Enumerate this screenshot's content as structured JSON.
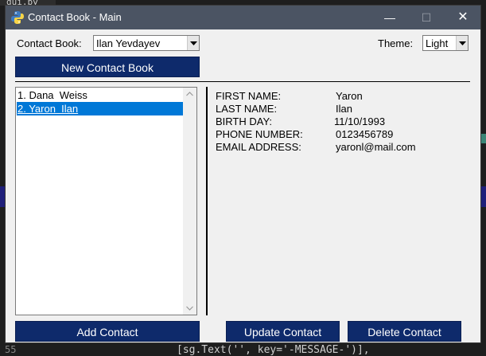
{
  "editor": {
    "tab_label": "gui.py",
    "line_number": "55",
    "code_line": "[sg.Text('', key='-MESSAGE-')],"
  },
  "window": {
    "title": "Contact Book - Main",
    "minimize_glyph": "—",
    "maximize_glyph": "☐",
    "close_glyph": "✕"
  },
  "header": {
    "contact_book_label": "Contact Book:",
    "contact_book_value": "Ilan Yevdayev",
    "theme_label": "Theme:",
    "theme_value": "Light",
    "new_contact_book_button": "New Contact Book"
  },
  "contacts": [
    {
      "label": "1. Dana  Weiss",
      "selected": false
    },
    {
      "label": "2. Yaron  Ilan",
      "selected": true
    }
  ],
  "details": {
    "first_name_label": "FIRST NAME:",
    "first_name_value": "Yaron",
    "last_name_label": "LAST NAME:",
    "last_name_value": "Ilan",
    "birthday_label": "BIRTH DAY:",
    "birthday_value": "11/10/1993",
    "phone_label": "PHONE NUMBER:",
    "phone_value": "0123456789",
    "email_label": "EMAIL ADDRESS:",
    "email_value": "yaronl@mail.com"
  },
  "actions": {
    "add_contact": "Add Contact",
    "update_contact": "Update Contact",
    "delete_contact": "Delete Contact"
  },
  "colors": {
    "button_bg": "#0e2a6b",
    "selection": "#0078d7",
    "titlebar": "#4b5463"
  }
}
